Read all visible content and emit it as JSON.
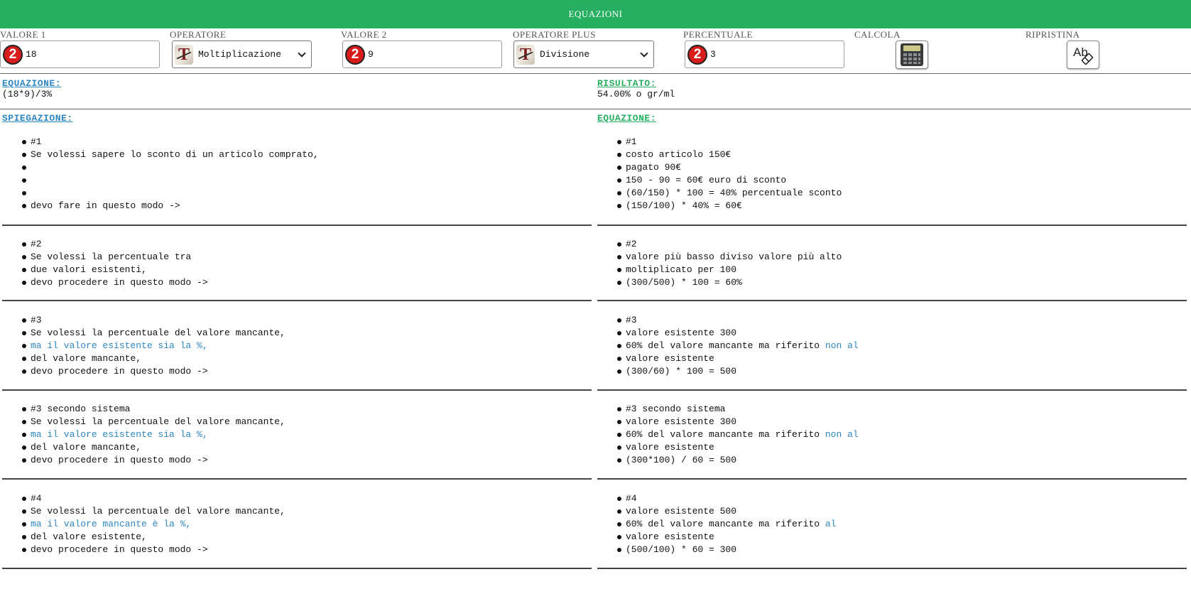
{
  "header": {
    "title": "EQUAZIONI"
  },
  "colors": {
    "accent": "#27ae60",
    "highlight": "#2e86c1",
    "badge": "#d81b1b"
  },
  "controls": {
    "valore1": {
      "label": "VALORE 1",
      "value": "18",
      "badge": "2"
    },
    "operatore": {
      "label": "OPERATORE",
      "selected": "Moltiplicazione"
    },
    "valore2": {
      "label": "VALORE 2",
      "value": "9",
      "badge": "2"
    },
    "operatore_plus": {
      "label": "OPERATORE PLUS",
      "selected": "Divisione"
    },
    "percentuale": {
      "label": "PERCENTUALE",
      "value": "3",
      "badge": "2"
    },
    "calcola": {
      "label": "CALCOLA",
      "icon": "calculator-icon"
    },
    "ripristina": {
      "label": "RIPRISTINA",
      "icon": "clear-text-icon"
    }
  },
  "result": {
    "equation_label": "EQUAZIONE:",
    "equation": "(18*9)/3%",
    "result_label": "RISULTATO:",
    "result": "54.00% o gr/ml"
  },
  "explanation": {
    "left_title": "SPIEGAZIONE:",
    "right_title": "EQUAZIONE:",
    "blocks": [
      {
        "left": [
          "#1",
          "Se volessi sapere lo sconto di un articolo comprato,",
          "",
          "",
          "",
          "devo fare in questo modo ->"
        ],
        "right": [
          "#1",
          "costo articolo 150€",
          "pagato 90€",
          "150 - 90 = 60€ euro di sconto",
          "(60/150) * 100 = 40% percentuale sconto",
          "(150/100) * 40% = 60€"
        ]
      },
      {
        "left": [
          "#2",
          "Se volessi la percentuale tra",
          "due valori esistenti,",
          "devo procedere in questo modo ->"
        ],
        "right": [
          "#2",
          "valore più basso diviso valore più alto",
          "moltiplicato per 100",
          "(300/500) * 100 = 60%"
        ]
      },
      {
        "left": [
          "#3",
          "Se volessi la percentuale del valore mancante,",
          "ma il valore esistente sia la %,",
          "del valore mancante,",
          "devo procedere in questo modo ->"
        ],
        "right": [
          "#3",
          "valore esistente 300",
          "60% del valore mancante ma riferito ",
          "non al",
          "valore esistente",
          "(300/60) * 100 = 500"
        ]
      },
      {
        "left": [
          "#3 secondo sistema",
          "Se volessi la percentuale del valore mancante,",
          "ma il valore esistente sia la %,",
          "del valore mancante,",
          "devo procedere in questo modo ->"
        ],
        "right": [
          "#3 secondo sistema",
          "valore esistente 300",
          "60% del valore mancante ma riferito ",
          "non al",
          "valore esistente",
          "(300*100) / 60 = 500"
        ]
      },
      {
        "left": [
          "#4",
          "Se volessi la percentuale del valore mancante,",
          "ma il valore mancante è la %,",
          "del valore esistente,",
          "devo procedere in questo modo ->"
        ],
        "right": [
          "#4",
          "valore esistente 500",
          "60% del valore mancante ma riferito ",
          "al",
          "valore esistente",
          "(500/100) * 60 = 300"
        ]
      }
    ]
  }
}
